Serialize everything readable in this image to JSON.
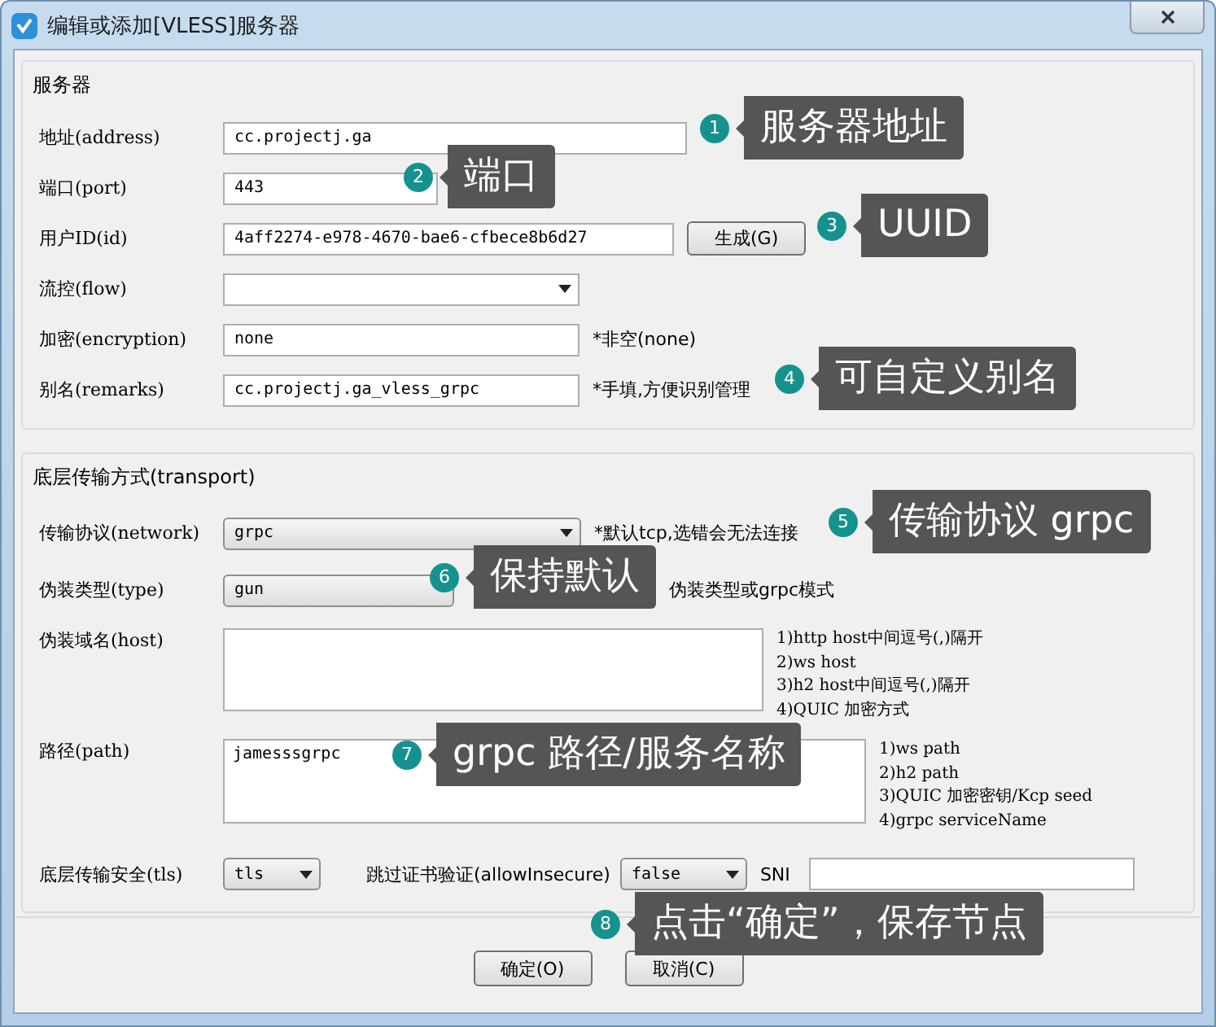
{
  "window": {
    "title": "编辑或添加[VLESS]服务器"
  },
  "server": {
    "title": "服务器",
    "fields": [
      {
        "label": "地址(address)",
        "kind": "text",
        "value": "cc.projectj.ga"
      },
      {
        "label": "端口(port)",
        "kind": "text",
        "value": "443"
      },
      {
        "label": "用户ID(id)",
        "kind": "text",
        "value": "4aff2274-e978-4670-bae6-cfbece8b6d27",
        "button": "生成(G)"
      },
      {
        "label": "流控(flow)",
        "kind": "select"
      },
      {
        "label": "加密(encryption)",
        "kind": "text",
        "value": "none",
        "note": "*非空(none)"
      },
      {
        "label": "别名(remarks)",
        "kind": "text",
        "value": "cc.projectj.ga_vless_grpc",
        "note": "*手填,方便识别管理"
      }
    ]
  },
  "transport": {
    "title": "底层传输方式(transport)",
    "fields": [
      {
        "label": "传输协议(network)",
        "kind": "select",
        "value": "grpc",
        "note": "*默认tcp,选错会无法连接"
      },
      {
        "label": "伪装类型(type)",
        "kind": "select",
        "value": "gun",
        "note": "伪装类型或grpc模式"
      },
      {
        "label": "伪装域名(host)",
        "kind": "textarea",
        "hints": [
          "1)http host中间逗号(,)隔开",
          "2)ws host",
          "3)h2 host中间逗号(,)隔开",
          "4)QUIC 加密方式"
        ]
      },
      {
        "label": "路径(path)",
        "kind": "textarea",
        "value": "jamesssgrpc",
        "hints": [
          "1)ws path",
          "2)h2 path",
          "3)QUIC 加密密钥/Kcp seed",
          "4)grpc serviceName"
        ]
      }
    ],
    "security": {
      "label": "底层传输安全(tls)",
      "value": "tls",
      "insecure_label": "跳过证书验证(allowInsecure)",
      "insecure_value": "false",
      "sni_label": "SNI"
    }
  },
  "buttons": [
    "确定(O)",
    "取消(C)"
  ],
  "callouts": [
    {
      "number": "1",
      "text": "服务器地址"
    },
    {
      "number": "2",
      "text": "端口"
    },
    {
      "number": "3",
      "text": "UUID"
    },
    {
      "number": "4",
      "text": "可自定义别名"
    },
    {
      "number": "5",
      "text": "传输协议 grpc"
    },
    {
      "number": "6",
      "text": "保持默认"
    },
    {
      "number": "7",
      "text": "grpc 路径/服务名称"
    },
    {
      "number": "8",
      "text": "点击“确定”，保存节点"
    }
  ]
}
